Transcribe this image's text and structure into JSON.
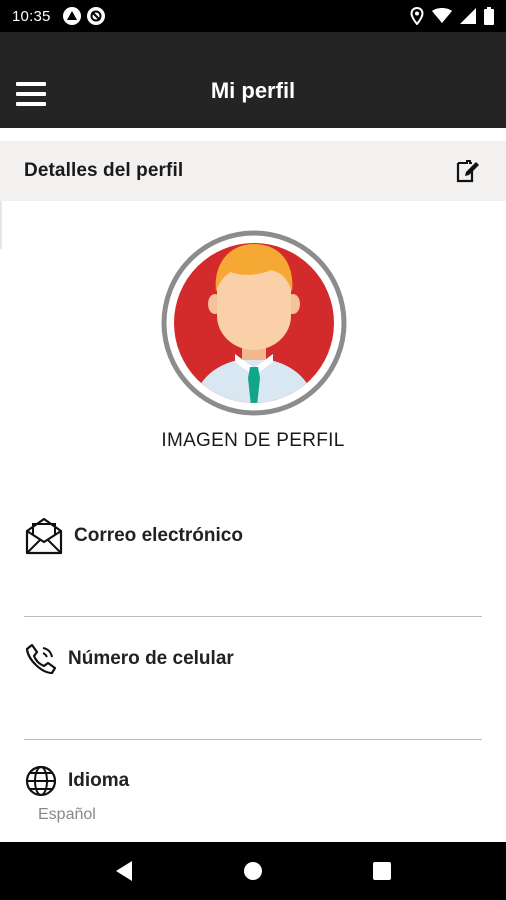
{
  "status_bar": {
    "time": "10:35",
    "left_icons": [
      "react-native-icon",
      "sync-blocked-icon"
    ],
    "right_icons": [
      "location-icon",
      "wifi-icon",
      "signal-icon",
      "battery-icon"
    ]
  },
  "app_bar": {
    "title": "Mi perfil",
    "menu_icon": "hamburger-menu-icon"
  },
  "section": {
    "title": "Detalles del perfil",
    "edit_icon": "edit-note-icon"
  },
  "avatar": {
    "caption": "IMAGEN DE PERFIL",
    "ring_color": "#8c8c8c",
    "background_color": "#d32a2c"
  },
  "fields": {
    "email": {
      "label": "Correo electrónico",
      "value": "",
      "icon": "envelope-icon"
    },
    "phone": {
      "label": "Número de celular",
      "value": "",
      "icon": "phone-icon"
    },
    "language": {
      "label": "Idioma",
      "value": "Español",
      "icon": "globe-icon"
    }
  },
  "nav_bar": {
    "items": [
      "back-triangle-icon",
      "home-circle-icon",
      "recents-square-icon"
    ]
  },
  "colors": {
    "app_bar": "#242424",
    "section_bg": "#f2f1f0",
    "divider": "#bdbdbd"
  }
}
